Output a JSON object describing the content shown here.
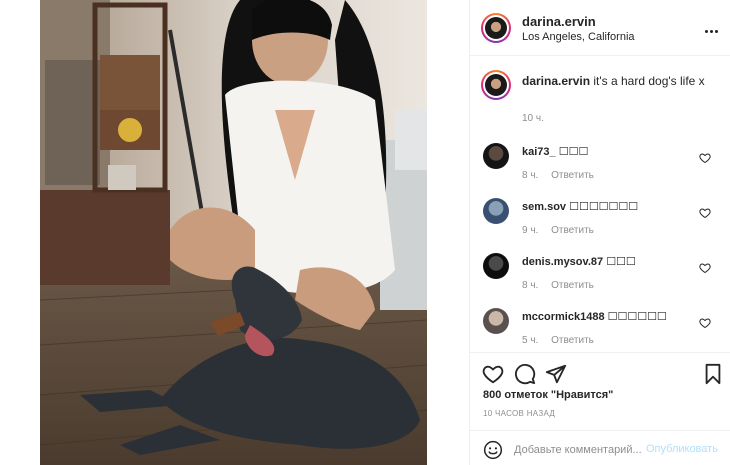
{
  "post": {
    "username": "darina.ervin",
    "location": "Los Angeles, California",
    "photo_alt": "Woman in white shirt crouching beside a grey dog"
  },
  "caption": {
    "username": "darina.ervin",
    "text": "it's a hard dog's life x",
    "time": "10 ч."
  },
  "comments": [
    {
      "username": "kai73_",
      "text": "☐☐☐",
      "time": "8 ч.",
      "reply": "Ответить"
    },
    {
      "username": "sem.sov",
      "text": "☐☐☐☐☐☐☐",
      "time": "9 ч.",
      "reply": "Ответить"
    },
    {
      "username": "denis.mysov.87",
      "text": "☐☐☐",
      "time": "8 ч.",
      "reply": "Ответить"
    },
    {
      "username": "mccormick1488",
      "text": "☐☐☐☐☐☐",
      "time": "5 ч.",
      "reply": "Ответить"
    }
  ],
  "actions": {
    "likes_text": "800 отметок \"Нравится\"",
    "posted": "10 ЧАСОВ НАЗАД"
  },
  "add_comment": {
    "placeholder": "Добавьте комментарий...",
    "publish": "Опубликовать"
  },
  "colors": {
    "text": "#262626",
    "muted": "#8e8e8e",
    "border": "#efefef",
    "publish_disabled": "#b2dffc"
  }
}
